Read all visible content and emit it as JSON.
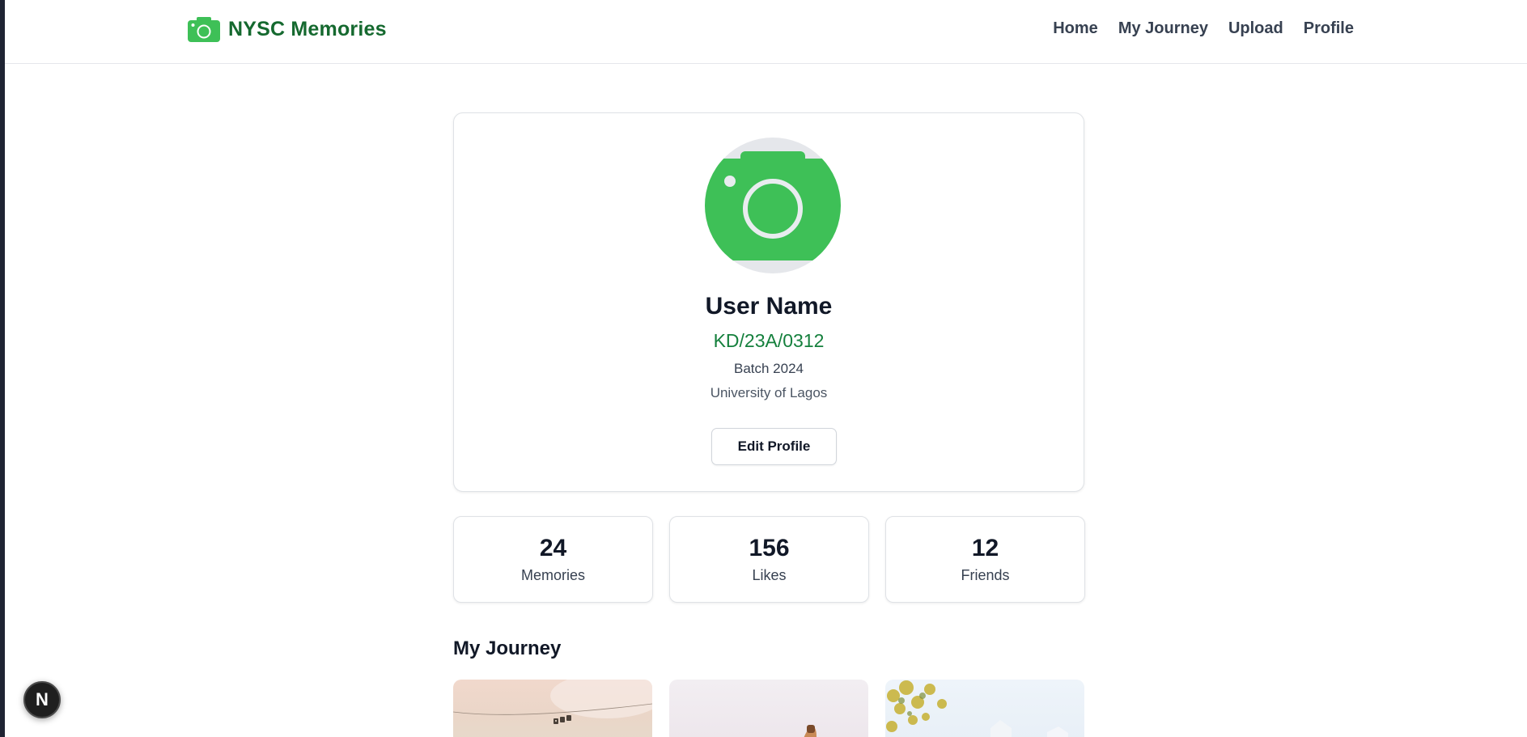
{
  "brand": {
    "name": "NYSC Memories",
    "icon": "camera-icon",
    "color": "#15692f",
    "icon_color": "#3ec057"
  },
  "nav": {
    "items": [
      {
        "label": "Home"
      },
      {
        "label": "My Journey"
      },
      {
        "label": "Upload"
      },
      {
        "label": "Profile"
      }
    ]
  },
  "profile": {
    "avatar_icon": "camera-icon",
    "name": "User Name",
    "code": "KD/23A/0312",
    "batch": "Batch 2024",
    "school": "University of Lagos",
    "edit_button": "Edit Profile",
    "code_color": "#15803d"
  },
  "stats": [
    {
      "value": "24",
      "label": "Memories"
    },
    {
      "value": "156",
      "label": "Likes"
    },
    {
      "value": "12",
      "label": "Friends"
    }
  ],
  "journey": {
    "title": "My Journey",
    "photos": [
      {
        "icon": "photo-thumbnail"
      },
      {
        "icon": "photo-thumbnail"
      },
      {
        "icon": "photo-thumbnail"
      }
    ]
  },
  "dev_indicator": {
    "label": "N",
    "icon": "nextjs-icon"
  }
}
